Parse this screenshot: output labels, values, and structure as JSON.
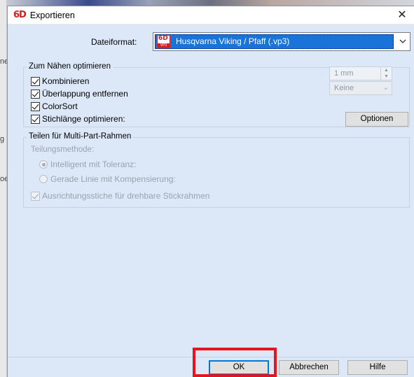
{
  "window": {
    "logo": "6D",
    "title": "Exportieren",
    "close_glyph": "✕"
  },
  "background_fragments": [
    "ne",
    "g",
    "oe"
  ],
  "format": {
    "label": "Dateiformat:",
    "selected": "Husqvarna Viking / Pfaff (.vp3)",
    "icon_top": "6D",
    "icon_bottom": "VP3"
  },
  "optimize_group": {
    "title": "Zum Nähen optimieren",
    "options": [
      {
        "label": "Kombinieren",
        "checked": true
      },
      {
        "label": "Überlappung entfernen",
        "checked": true
      },
      {
        "label": "ColorSort",
        "checked": true
      },
      {
        "label": "Stichlänge optimieren:",
        "checked": true
      }
    ],
    "options_button": "Optionen"
  },
  "multipart_group": {
    "title": "Teilen für Multi-Part-Rahmen",
    "method_label": "Teilungsmethode:",
    "radio_intelligent": "Intelligent mit Toleranz:",
    "radio_straight": "Gerade Linie mit Kompensierung:",
    "tolerance_value": "1 mm",
    "compensation_value": "Keine",
    "alignment_label": "Ausrichtungsstiche für drehbare Stickrahmen"
  },
  "footer": {
    "ok": "OK",
    "cancel": "Abbrechen",
    "help": "Hilfe"
  },
  "colors": {
    "selection_blue": "#1a73d9",
    "highlight_red": "#e8141c",
    "dialog_bg": "#dce8f7"
  }
}
